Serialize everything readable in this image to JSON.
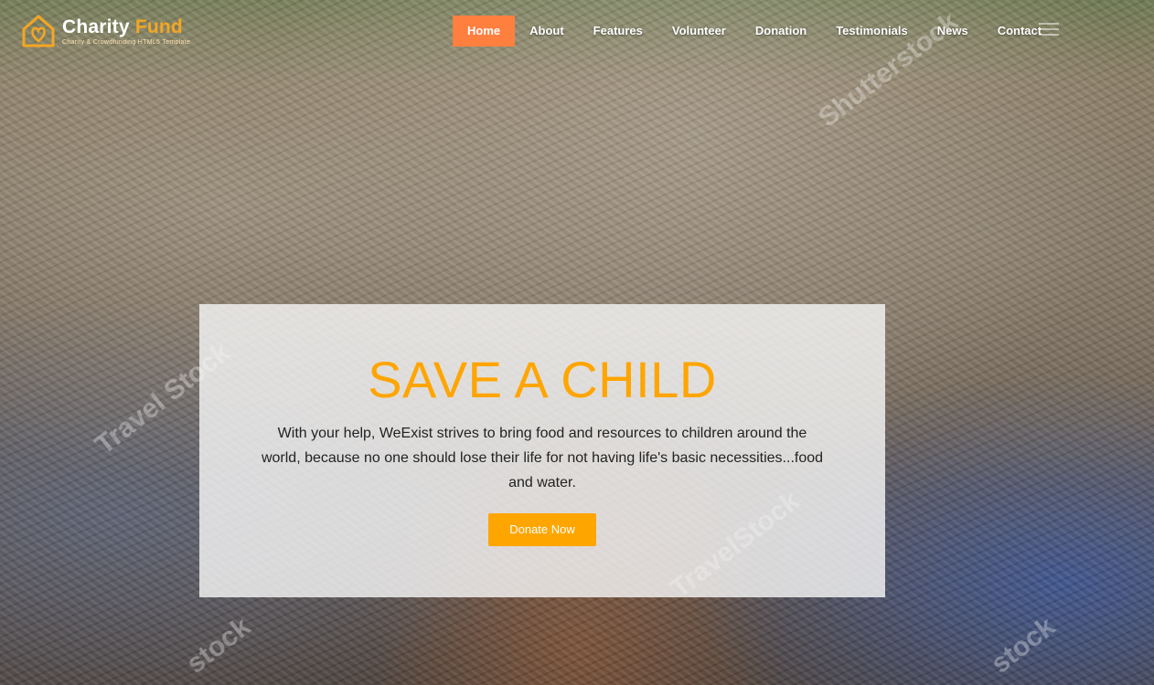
{
  "brand": {
    "name_part1": "Charity",
    "name_part2": "Fund",
    "tagline": "Charity & Crowdfunding HTML5 Template",
    "logo_icon": "heart-house-icon",
    "accent_color": "#f5a623"
  },
  "nav": {
    "items": [
      {
        "label": "Home",
        "active": true
      },
      {
        "label": "About",
        "active": false
      },
      {
        "label": "Features",
        "active": false
      },
      {
        "label": "Volunteer",
        "active": false
      },
      {
        "label": "Donation",
        "active": false
      },
      {
        "label": "Testimonials",
        "active": false
      },
      {
        "label": "News",
        "active": false
      },
      {
        "label": "Contact",
        "active": false
      }
    ],
    "active_color": "#ff7f3f",
    "menu_icon": "hamburger-icon"
  },
  "hero": {
    "title": "SAVE A CHILD",
    "text": "With your help, WeExist strives to bring food and resources to children around the world, because no one should lose their life for not having life's basic necessities...food and water.",
    "button_label": "Donate Now",
    "title_color": "#ffa500",
    "button_color": "#ffa500"
  },
  "watermarks": [
    "Travel Stock",
    "TravelStock",
    "stock",
    "stock",
    "Shutterstock"
  ]
}
